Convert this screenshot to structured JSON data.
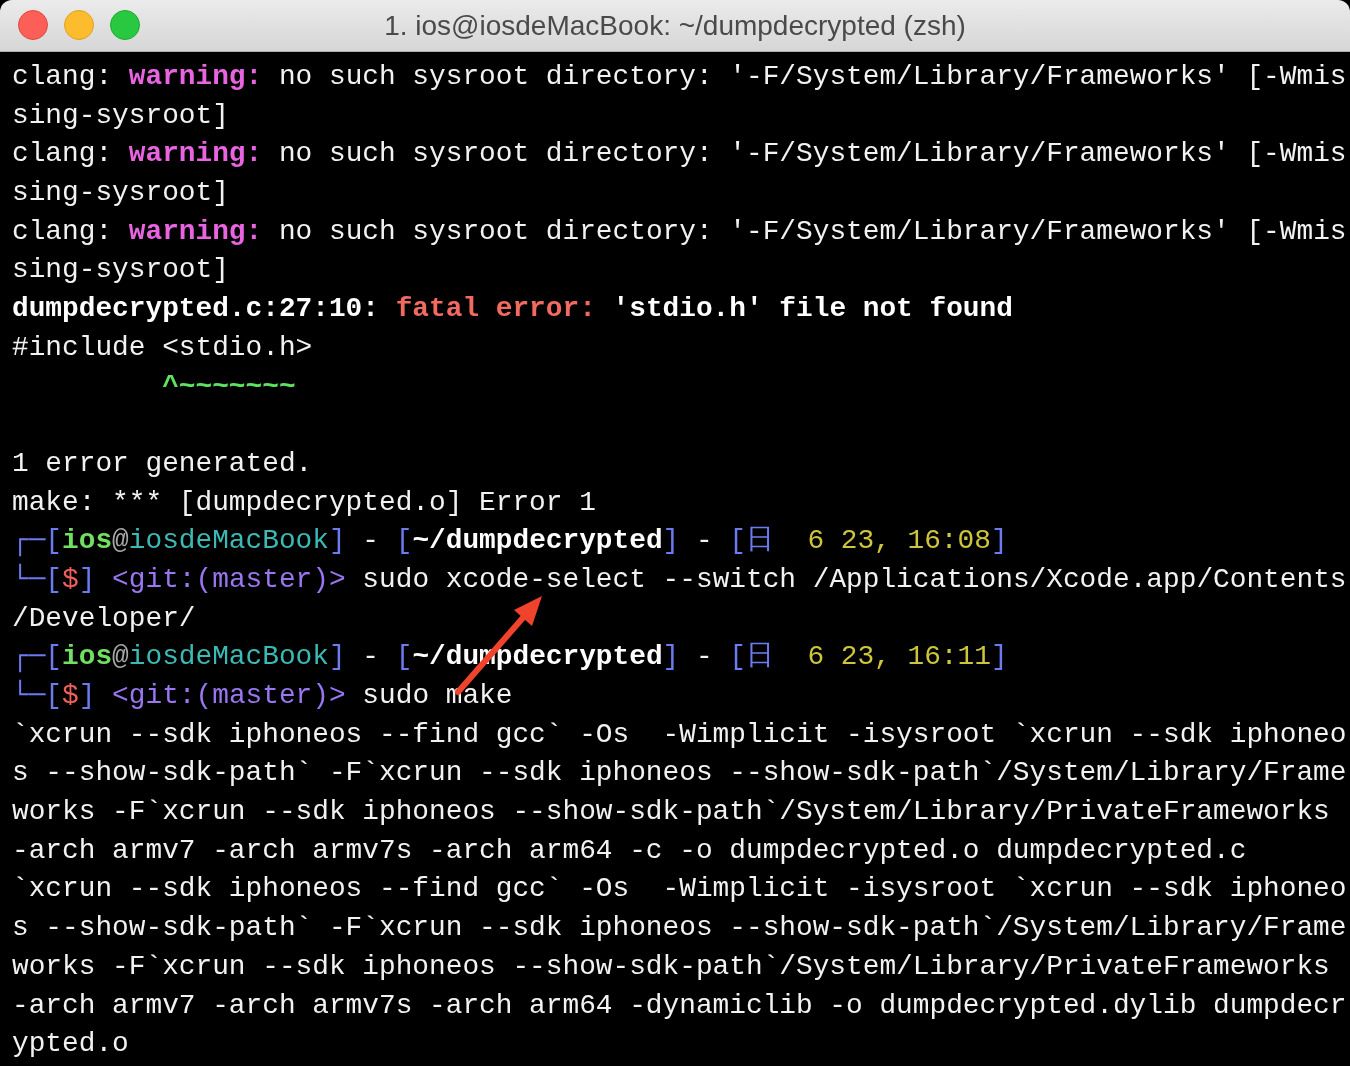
{
  "window": {
    "title": "1. ios@iosdeMacBook: ~/dumpdecrypted (zsh)"
  },
  "lines": [
    {
      "kind": "text",
      "segments": [
        {
          "kind": "plain",
          "text": "clang: "
        },
        {
          "kind": "warning",
          "text": "warning:"
        },
        {
          "kind": "plain",
          "text": " no such sysroot directory: '-F/System/Library/Frameworks' [-Wmis"
        }
      ]
    },
    {
      "kind": "text",
      "segments": [
        {
          "kind": "plain",
          "text": "sing-sysroot]"
        }
      ]
    },
    {
      "kind": "text",
      "segments": [
        {
          "kind": "plain",
          "text": "clang: "
        },
        {
          "kind": "warning",
          "text": "warning:"
        },
        {
          "kind": "plain",
          "text": " no such sysroot directory: '-F/System/Library/Frameworks' [-Wmis"
        }
      ]
    },
    {
      "kind": "text",
      "segments": [
        {
          "kind": "plain",
          "text": "sing-sysroot]"
        }
      ]
    },
    {
      "kind": "text",
      "segments": [
        {
          "kind": "plain",
          "text": "clang: "
        },
        {
          "kind": "warning",
          "text": "warning:"
        },
        {
          "kind": "plain",
          "text": " no such sysroot directory: '-F/System/Library/Frameworks' [-Wmis"
        }
      ]
    },
    {
      "kind": "text",
      "segments": [
        {
          "kind": "plain",
          "text": "sing-sysroot]"
        }
      ]
    },
    {
      "kind": "text",
      "segments": [
        {
          "kind": "bold",
          "text": "dumpdecrypted.c:27:10: "
        },
        {
          "kind": "error",
          "text": "fatal error:"
        },
        {
          "kind": "bold",
          "text": " 'stdio.h' file not found"
        }
      ]
    },
    {
      "kind": "text",
      "segments": [
        {
          "kind": "plain",
          "text": "#include <stdio.h>"
        }
      ]
    },
    {
      "kind": "text",
      "segments": [
        {
          "kind": "caret",
          "text": "         ^~~~~~~~"
        }
      ]
    },
    {
      "kind": "blank"
    },
    {
      "kind": "text",
      "segments": [
        {
          "kind": "plain",
          "text": "1 error generated."
        }
      ]
    },
    {
      "kind": "text",
      "segments": [
        {
          "kind": "plain",
          "text": "make: *** [dumpdecrypted.o] Error 1"
        }
      ]
    },
    {
      "kind": "text",
      "segments": [
        {
          "kind": "bracket",
          "text": "┌─["
        },
        {
          "kind": "user",
          "text": "ios"
        },
        {
          "kind": "at",
          "text": "@"
        },
        {
          "kind": "host",
          "text": "iosdeMacBook"
        },
        {
          "kind": "bracket",
          "text": "]"
        },
        {
          "kind": "plain",
          "text": " - "
        },
        {
          "kind": "bracket",
          "text": "["
        },
        {
          "kind": "bold",
          "text": "~/dumpdecrypted"
        },
        {
          "kind": "bracket",
          "text": "]"
        },
        {
          "kind": "plain",
          "text": " - "
        },
        {
          "kind": "bracket",
          "text": "[日  "
        },
        {
          "kind": "date",
          "text": "6 23, 16:08"
        },
        {
          "kind": "bracket",
          "text": "]"
        }
      ]
    },
    {
      "kind": "text",
      "segments": [
        {
          "kind": "bracket",
          "text": "└─["
        },
        {
          "kind": "dollar",
          "text": "$"
        },
        {
          "kind": "bracket",
          "text": "] "
        },
        {
          "kind": "git",
          "text": "<git:(master)>"
        },
        {
          "kind": "plain",
          "text": " sudo xcode-select --switch /Applications/Xcode.app/Contents"
        }
      ]
    },
    {
      "kind": "text",
      "segments": [
        {
          "kind": "plain",
          "text": "/Developer/"
        }
      ]
    },
    {
      "kind": "text",
      "segments": [
        {
          "kind": "bracket",
          "text": "┌─["
        },
        {
          "kind": "user",
          "text": "ios"
        },
        {
          "kind": "at",
          "text": "@"
        },
        {
          "kind": "host",
          "text": "iosdeMacBook"
        },
        {
          "kind": "bracket",
          "text": "]"
        },
        {
          "kind": "plain",
          "text": " - "
        },
        {
          "kind": "bracket",
          "text": "["
        },
        {
          "kind": "bold",
          "text": "~/dumpdecrypted"
        },
        {
          "kind": "bracket",
          "text": "]"
        },
        {
          "kind": "plain",
          "text": " - "
        },
        {
          "kind": "bracket",
          "text": "[日  "
        },
        {
          "kind": "date",
          "text": "6 23, 16:11"
        },
        {
          "kind": "bracket",
          "text": "]"
        }
      ]
    },
    {
      "kind": "text",
      "segments": [
        {
          "kind": "bracket",
          "text": "└─["
        },
        {
          "kind": "dollar",
          "text": "$"
        },
        {
          "kind": "bracket",
          "text": "] "
        },
        {
          "kind": "git",
          "text": "<git:(master)>"
        },
        {
          "kind": "plain",
          "text": " sudo make"
        }
      ]
    },
    {
      "kind": "text",
      "segments": [
        {
          "kind": "plain",
          "text": "`xcrun --sdk iphoneos --find gcc` -Os  -Wimplicit -isysroot `xcrun --sdk iphoneo"
        }
      ]
    },
    {
      "kind": "text",
      "segments": [
        {
          "kind": "plain",
          "text": "s --show-sdk-path` -F`xcrun --sdk iphoneos --show-sdk-path`/System/Library/Frame"
        }
      ]
    },
    {
      "kind": "text",
      "segments": [
        {
          "kind": "plain",
          "text": "works -F`xcrun --sdk iphoneos --show-sdk-path`/System/Library/PrivateFrameworks"
        }
      ]
    },
    {
      "kind": "text",
      "segments": [
        {
          "kind": "plain",
          "text": "-arch armv7 -arch armv7s -arch arm64 -c -o dumpdecrypted.o dumpdecrypted.c"
        }
      ]
    },
    {
      "kind": "text",
      "segments": [
        {
          "kind": "plain",
          "text": "`xcrun --sdk iphoneos --find gcc` -Os  -Wimplicit -isysroot `xcrun --sdk iphoneo"
        }
      ]
    },
    {
      "kind": "text",
      "segments": [
        {
          "kind": "plain",
          "text": "s --show-sdk-path` -F`xcrun --sdk iphoneos --show-sdk-path`/System/Library/Frame"
        }
      ]
    },
    {
      "kind": "text",
      "segments": [
        {
          "kind": "plain",
          "text": "works -F`xcrun --sdk iphoneos --show-sdk-path`/System/Library/PrivateFrameworks"
        }
      ]
    },
    {
      "kind": "text",
      "segments": [
        {
          "kind": "plain",
          "text": "-arch armv7 -arch armv7s -arch arm64 -dynamiclib -o dumpdecrypted.dylib dumpdecr"
        }
      ]
    },
    {
      "kind": "text",
      "segments": [
        {
          "kind": "plain",
          "text": "ypted.o"
        }
      ]
    }
  ]
}
